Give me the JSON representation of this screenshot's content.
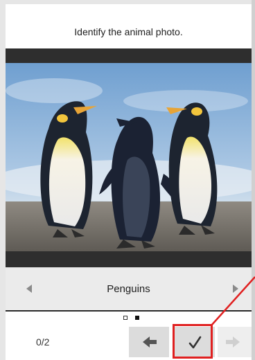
{
  "quiz": {
    "instruction": "Identify the animal photo.",
    "answer": "Penguins",
    "progress": "0/2",
    "total_pages": 2,
    "current_page": 2
  },
  "icons": {
    "prev_option": "left-triangle-icon",
    "next_option": "right-triangle-icon",
    "back": "left-arrow-icon",
    "submit": "checkmark-icon",
    "forward": "right-arrow-icon"
  },
  "colors": {
    "highlight": "#e02020",
    "photo_border": "#2e2e2e"
  }
}
